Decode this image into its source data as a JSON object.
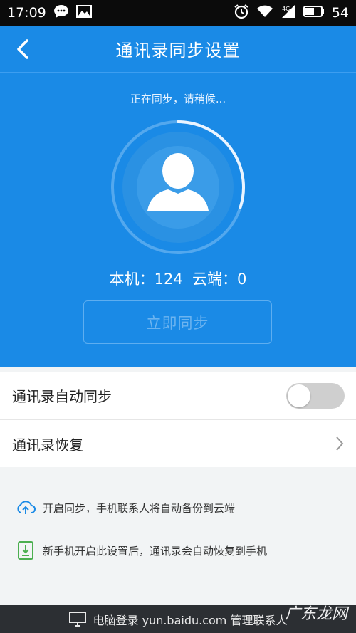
{
  "status_bar": {
    "time": "17:09",
    "battery": "54",
    "icons_left": [
      "chat-icon",
      "image-icon"
    ],
    "icons_right": [
      "alarm-icon",
      "wifi-icon",
      "signal-4g-icon",
      "battery-icon"
    ]
  },
  "header": {
    "title": "通讯录同步设置",
    "back_icon": "chevron-left-icon"
  },
  "hero": {
    "sync_status": "正在同步，请稍候...",
    "counts": "本机：124  云端：0",
    "sync_button": "立即同步",
    "progress_fraction": 0.3
  },
  "settings": {
    "auto_sync_label": "通讯录自动同步",
    "auto_sync_enabled": false,
    "restore_label": "通讯录恢复"
  },
  "info": {
    "line1": "开启同步，手机联系人将自动备份到云端",
    "line2": "新手机开启此设置后，通讯录会自动恢复到手机"
  },
  "bottom_bar": {
    "text": "电脑登录 yun.baidu.com 管理联系人"
  },
  "watermark": "广东龙网",
  "colors": {
    "accent": "#1a8ae6",
    "bottom_bar": "#2c2f33"
  }
}
